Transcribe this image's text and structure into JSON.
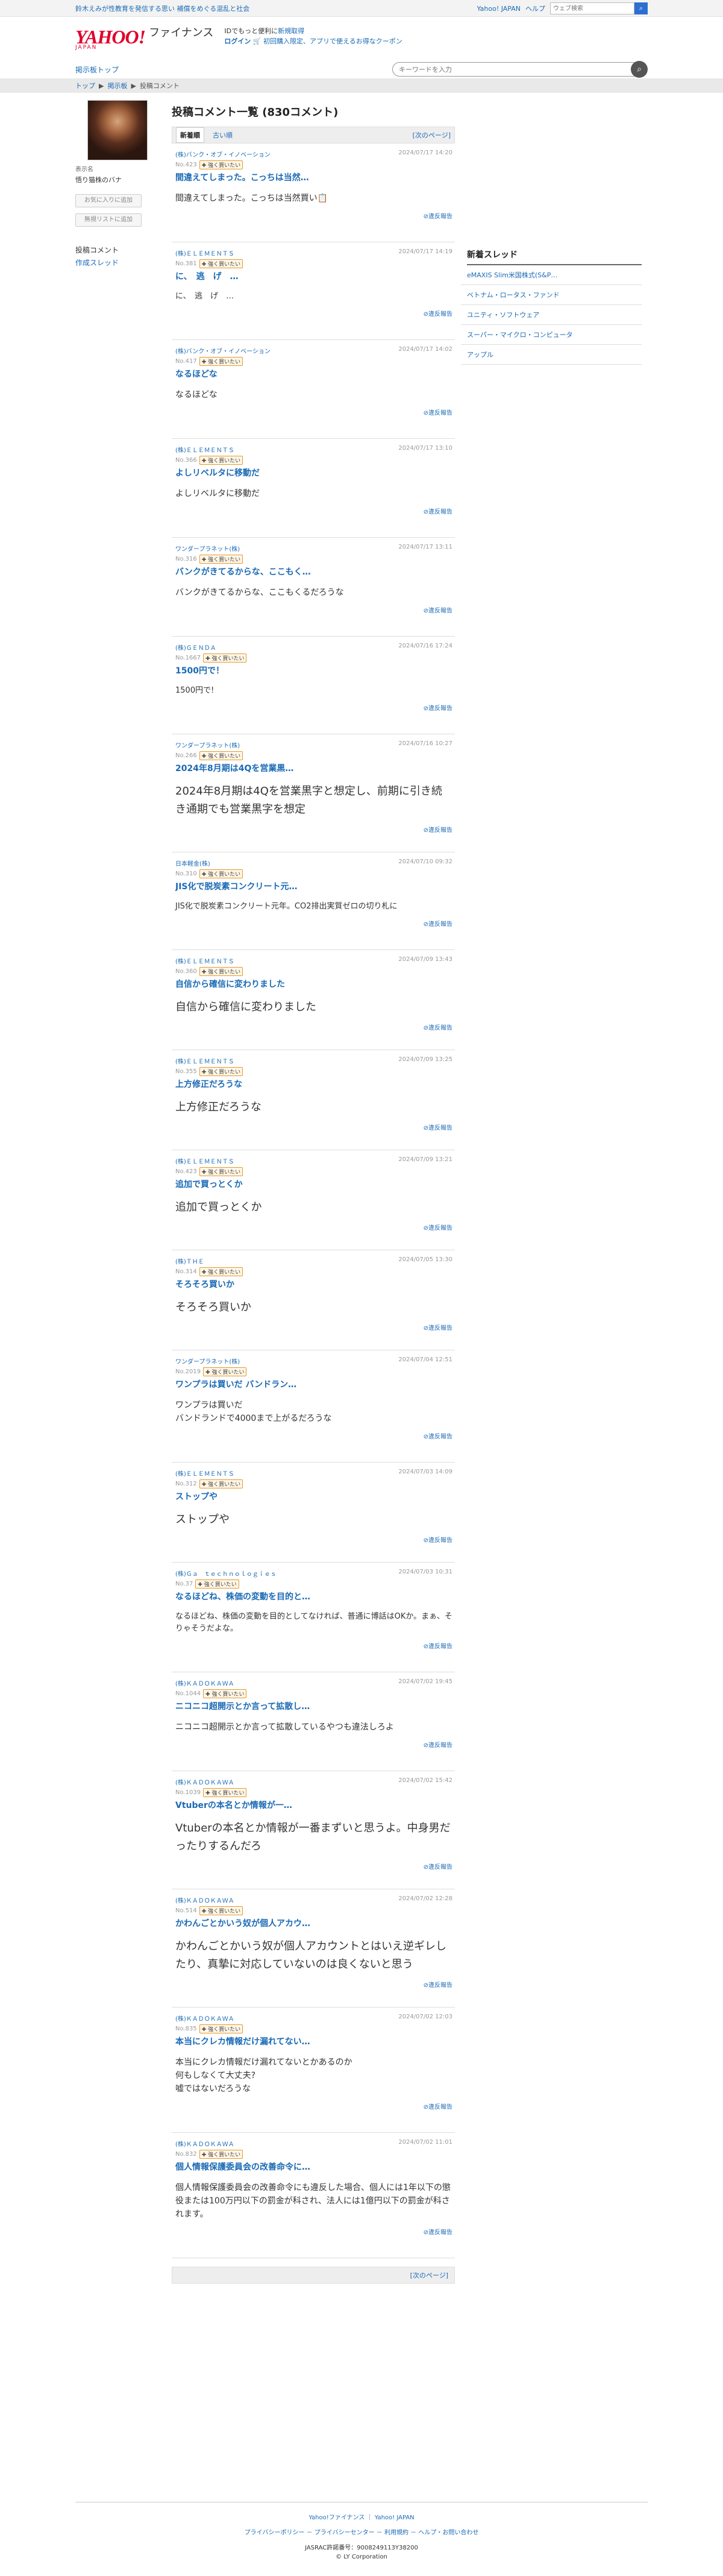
{
  "topbar": {
    "headline": "鈴木えみが性教育を発信する思い 補償をめぐる混乱と社会",
    "links": [
      "Yahoo! JAPAN",
      "ヘルプ"
    ],
    "search_placeholder": "ウェブ検索"
  },
  "header": {
    "logo_main": "YAHOO!",
    "logo_sub": "JAPAN",
    "service": "ファイナンス",
    "msg_line1_prefix": "IDでもっと便利に",
    "msg_line1_link": "新規取得",
    "msg_line2_login": "ログイン",
    "msg_line2_text": "初回購入限定、アプリで使えるお得なクーポン"
  },
  "nav": {
    "board_top": "掲示板トップ",
    "keyword_placeholder": "キーワードを入力"
  },
  "breadcrumb": [
    "トップ",
    "掲示板",
    "投稿コメント"
  ],
  "profile": {
    "role": "表示名",
    "name": "悟り猫株のバナ",
    "btn_fav": "お気に入りに追加",
    "btn_ignore": "無視リストに追加",
    "link_comments": "投稿コメント",
    "link_threads": "作成スレッド"
  },
  "center": {
    "title": "投稿コメント一覧 (830コメント)",
    "tab_new": "新着順",
    "tab_old": "古い順",
    "next_page": "[次のページ]",
    "report_label": "違反報告"
  },
  "posts": [
    {
      "board": "(株)バンク・オブ・イノベーション",
      "no": "No.423",
      "badge": "強く買いたい",
      "time": "2024/07/17 14:20",
      "title": "間違えてしまった。こっちは当然…",
      "body": "間違えてしまった。こっちは当然買い📋",
      "size": "m"
    },
    {
      "board": "(株)ＥＬＥＭＥＮＴＳ",
      "no": "No.381",
      "badge": "強く買いたい",
      "time": "2024/07/17 14:19",
      "title": "に、　逃　げ　…",
      "body": "に、　逃　げ　…",
      "size": "s"
    },
    {
      "board": "(株)バンク・オブ・イノベーション",
      "no": "No.417",
      "badge": "強く買いたい",
      "time": "2024/07/17 14:02",
      "title": "なるほどな",
      "body": "なるほどな",
      "size": "m"
    },
    {
      "board": "(株)ＥＬＥＭＥＮＴＳ",
      "no": "No.366",
      "badge": "強く買いたい",
      "time": "2024/07/17 13:10",
      "title": "よしリベルタに移動だ",
      "body": "よしリベルタに移動だ",
      "size": "m"
    },
    {
      "board": "ワンダープラネット(株)",
      "no": "No.316",
      "badge": "強く買いたい",
      "time": "2024/07/17 13:11",
      "title": "バンクがきてるからな、ここもく…",
      "body": "バンクがきてるからな、ここもくるだろうな",
      "size": "m"
    },
    {
      "board": "(株)ＧＥＮＤＡ",
      "no": "No.1667",
      "badge": "強く買いたい",
      "time": "2024/07/16 17:24",
      "title": "1500円で！",
      "body": "1500円で!",
      "size": "s"
    },
    {
      "board": "ワンダープラネット(株)",
      "no": "No.266",
      "badge": "強く買いたい",
      "time": "2024/07/16 10:27",
      "title": "2024年8月期は4Qを営業黒…",
      "body": "2024年8月期は4Qを営業黒字と想定し、前期に引き続き通期でも営業黒字を想定",
      "size": "l"
    },
    {
      "board": "日本軽金(株)",
      "no": "No.310",
      "badge": "強く買いたい",
      "time": "2024/07/10 09:32",
      "title": "JIS化で脱炭素コンクリート元…",
      "body": "JIS化で脱炭素コンクリート元年。CO2排出実質ゼロの切り札に",
      "size": "s"
    },
    {
      "board": "(株)ＥＬＥＭＥＮＴＳ",
      "no": "No.360",
      "badge": "強く買いたい",
      "time": "2024/07/09 13:43",
      "title": "自信から確信に変わりました",
      "body": "自信から確信に変わりました",
      "size": "l"
    },
    {
      "board": "(株)ＥＬＥＭＥＮＴＳ",
      "no": "No.355",
      "badge": "強く買いたい",
      "time": "2024/07/09 13:25",
      "title": "上方修正だろうな",
      "body": "上方修正だろうな",
      "size": "l"
    },
    {
      "board": "(株)ＥＬＥＭＥＮＴＳ",
      "no": "No.423",
      "badge": "強く買いたい",
      "time": "2024/07/09 13:21",
      "title": "追加で買っとくか",
      "body": "追加で買っとくか",
      "size": "l"
    },
    {
      "board": "(株)ＴＨＥ",
      "no": "No.314",
      "badge": "強く買いたい",
      "time": "2024/07/05 13:30",
      "title": "そろそろ買いか",
      "body": "そろそろ買いか",
      "size": "l"
    },
    {
      "board": "ワンダープラネット(株)",
      "no": "No.2019",
      "badge": "強く買いたい",
      "time": "2024/07/04 12:51",
      "title": "ワンプラは買いだ バンドラン…",
      "body": "ワンプラは買いだ\nバンドランドで4000まで上がるだろうな",
      "size": "m"
    },
    {
      "board": "(株)ＥＬＥＭＥＮＴＳ",
      "no": "No.312",
      "badge": "強く買いたい",
      "time": "2024/07/03 14:09",
      "title": "ストップや",
      "body": "ストップや",
      "size": "l"
    },
    {
      "board": "(株)Ｇａ　ｔｅｃｈｎｏｌｏｇｉｅｓ",
      "no": "No.37",
      "badge": "強く買いたい",
      "time": "2024/07/03 10:31",
      "title": "なるほどね、株価の変動を目的と…",
      "body": "なるほどね、株価の変動を目的としてなければ、普通に博話はOKか。まぁ、そりゃそうだよな。",
      "size": "s"
    },
    {
      "board": "(株)ＫＡＤＯＫＡＷＡ",
      "no": "No.1044",
      "badge": "強く買いたい",
      "time": "2024/07/02 19:45",
      "title": "ニコニコ超開示とか言って拡散し…",
      "body": "ニコニコ超開示とか言って拡散しているやつも違法しろよ",
      "size": "m"
    },
    {
      "board": "(株)ＫＡＤＯＫＡＷＡ",
      "no": "No.1039",
      "badge": "強く買いたい",
      "time": "2024/07/02 15:42",
      "title": "Vtuberの本名とか情報が一…",
      "body": "Vtuberの本名とか情報が一番まずいと思うよ。中身男だったりするんだろ",
      "size": "l"
    },
    {
      "board": "(株)ＫＡＤＯＫＡＷＡ",
      "no": "No.514",
      "badge": "強く買いたい",
      "time": "2024/07/02 12:28",
      "title": "かわんごとかいう奴が個人アカウ…",
      "body": "かわんごとかいう奴が個人アカウントとはいえ逆ギレしたり、真摯に対応していないのは良くないと思う",
      "size": "l"
    },
    {
      "board": "(株)ＫＡＤＯＫＡＷＡ",
      "no": "No.835",
      "badge": "強く買いたい",
      "time": "2024/07/02 12:03",
      "title": "本当にクレカ情報だけ漏れてない…",
      "body": "本当にクレカ情報だけ漏れてないとかあるのか\n何もしなくて大丈夫?\n嘘ではないだろうな",
      "size": "m"
    },
    {
      "board": "(株)ＫＡＤＯＫＡＷＡ",
      "no": "No.832",
      "badge": "強く買いたい",
      "time": "2024/07/02 11:01",
      "title": "個人情報保護委員会の改善命令に…",
      "body": "個人情報保護委員会の改善命令にも違反した場合、個人には1年以下の懲役または100万円以下の罰金が科され、法人には1億円以下の罰金が科されます。",
      "size": "m"
    }
  ],
  "right": {
    "heading": "新着スレッド",
    "items": [
      "eMAXIS Slim米国株式(S&P…",
      "ベトナム・ロータス・ファンド",
      "ユニティ・ソフトウェア",
      "スーパー・マイクロ・コンピュータ",
      "アップル"
    ]
  },
  "footer": {
    "links1": "Yahoo!ファイナンス ｜ Yahoo! JAPAN",
    "links2": "プライバシーポリシー － プライバシーセンター － 利用規約 － ヘルプ・お問い合わせ",
    "license": "JASRAC許諾番号：9008249113Y38200",
    "copyright": "© LY Corporation"
  },
  "colors": {
    "link": "#1a6ab5",
    "brand_red": "#e0002a",
    "badge_border": "#e59a2b"
  }
}
